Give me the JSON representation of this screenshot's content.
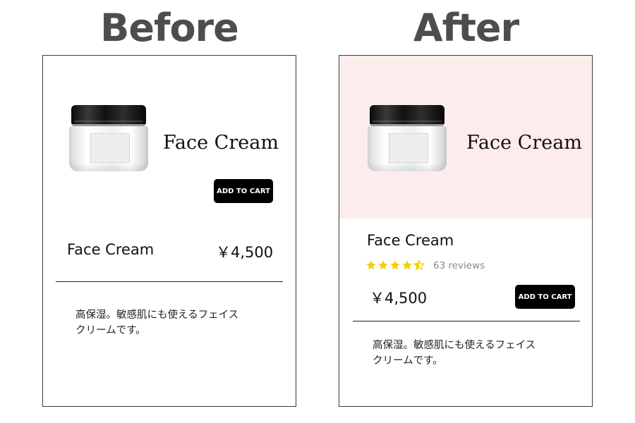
{
  "headings": {
    "before": "Before",
    "after": "After"
  },
  "before_card": {
    "hero_title": "Face Cream",
    "add_to_cart": "ADD TO CART",
    "product_name": "Face Cream",
    "price": "￥4,500",
    "description_line1": "高保湿。敏感肌にも使えるフェイス",
    "description_line2": "クリームです。"
  },
  "after_card": {
    "hero_title": "Face Cream",
    "hero_background": "#fdecec",
    "product_name": "Face Cream",
    "rating": 4.5,
    "rating_max": 5,
    "star_color": "#f5d000",
    "reviews": "63 reviews",
    "price": "￥4,500",
    "add_to_cart": "ADD TO CART",
    "description_line1": "高保湿。敏感肌にも使えるフェイス",
    "description_line2": "クリームです。"
  },
  "icons": {
    "product_image": "face-cream-jar",
    "star": "star-icon",
    "star_half": "star-half-icon"
  }
}
